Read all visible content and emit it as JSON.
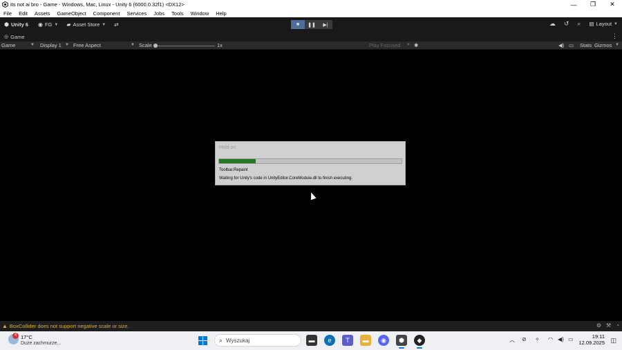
{
  "window": {
    "title": "its not ai bro - Game - Windows, Mac, Linux - Unity 6 (6000.0.32f1) <DX12>",
    "minimize": "—",
    "maximize": "❐",
    "close": "✕"
  },
  "menu": [
    "File",
    "Edit",
    "Assets",
    "GameObject",
    "Component",
    "Services",
    "Jobs",
    "Tools",
    "Window",
    "Help"
  ],
  "toolbar": {
    "unity_label": "Unity 6",
    "account_label": "FG",
    "asset_store_label": "Asset Store",
    "layout_label": "Layout"
  },
  "tab": {
    "game_label": "Game"
  },
  "game_bar": {
    "view_label": "Game",
    "display_label": "Display 1",
    "aspect_label": "Free Aspect",
    "scale_label": "Scale",
    "scale_value": "1x",
    "play_focused_label": "Play Focused",
    "stats_label": "Stats",
    "gizmos_label": "Gizmos"
  },
  "dialog": {
    "title": "Hold on",
    "progress": 0.2,
    "item": "Toolbar.Repaint",
    "message": "Waiting for Unity's code in UnityEditor.CoreModule.dll to finish executing."
  },
  "status": {
    "warning": "BoxCollider does not support negative scale or size."
  },
  "taskbar": {
    "weather_badge": "4",
    "weather_temp": "17°C",
    "weather_desc": "Duże zachmurze...",
    "search_placeholder": "Wyszukaj",
    "time": "19:11",
    "date": "12.09.2025"
  },
  "colors": {
    "accent_blue": "#4b6d96",
    "progress_green": "#217a21",
    "warning_yellow": "#e0b030"
  }
}
